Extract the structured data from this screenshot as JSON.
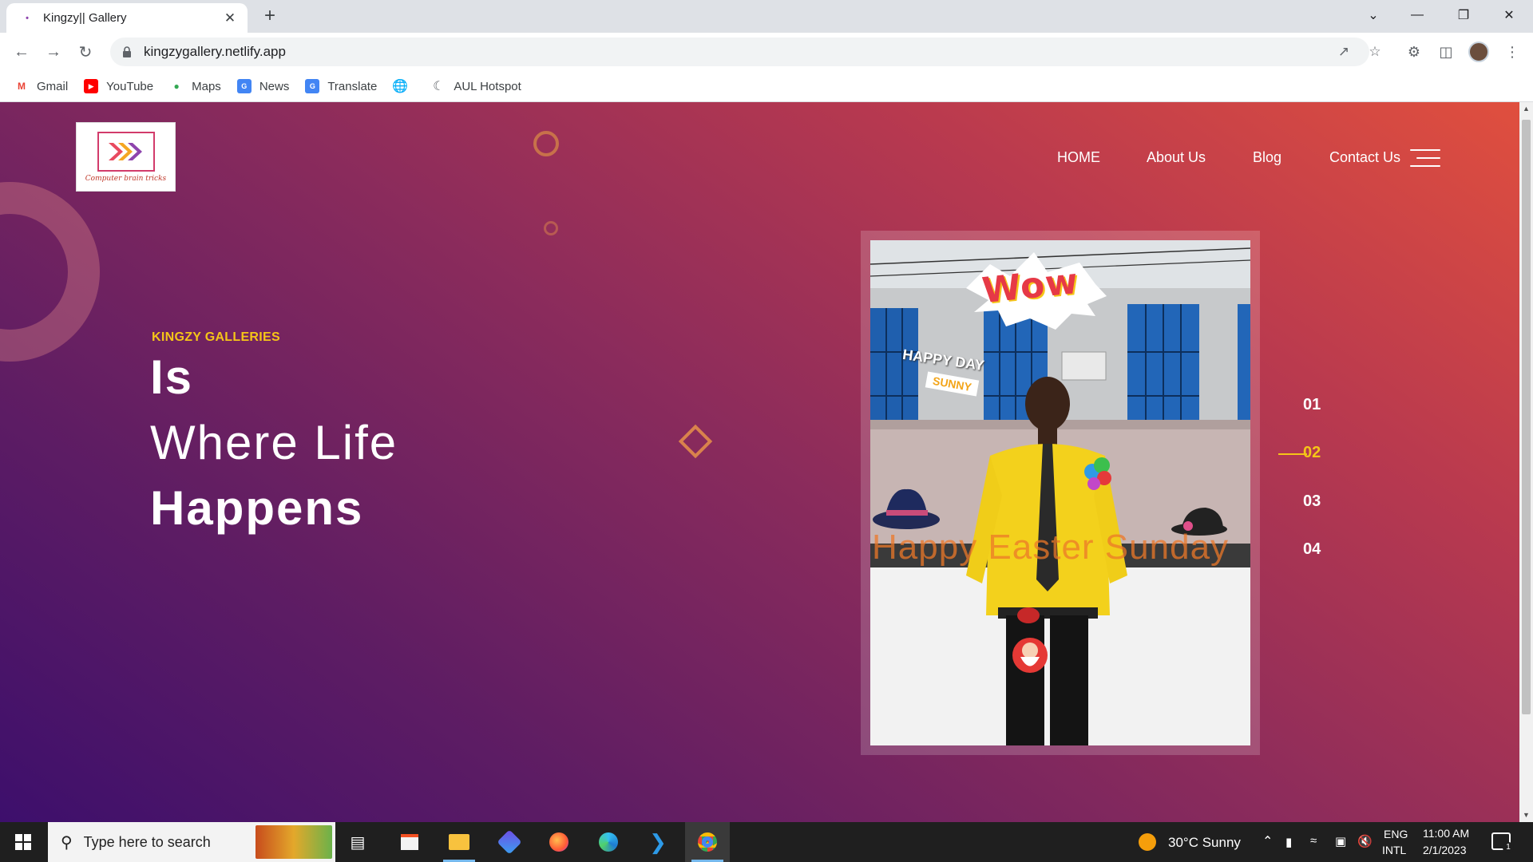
{
  "browser": {
    "tab_title": "Kingzy|| Gallery",
    "url": "kingzygallery.netlify.app",
    "bookmarks": [
      {
        "label": "Gmail",
        "icon": "gmail-icon",
        "color": "#ea4335"
      },
      {
        "label": "YouTube",
        "icon": "youtube-icon",
        "color": "#ff0000"
      },
      {
        "label": "Maps",
        "icon": "maps-icon",
        "color": "#34a853"
      },
      {
        "label": "News",
        "icon": "news-icon",
        "color": "#4285f4"
      },
      {
        "label": "Translate",
        "icon": "translate-icon",
        "color": "#4285f4"
      },
      {
        "label": "",
        "icon": "globe-icon",
        "color": "#5f6368"
      },
      {
        "label": "AUL Hotspot",
        "icon": "hotspot-icon",
        "color": "#5f6368"
      }
    ]
  },
  "site": {
    "logo_text": "Computer brain tricks",
    "nav": [
      "HOME",
      "About Us",
      "Blog",
      "Contact Us"
    ],
    "hero": {
      "subtitle": "KINGZY GALLERIES",
      "line1": "Is",
      "line2": "Where Life",
      "line3": "Happens"
    },
    "photo": {
      "sticker_wow": "Wow",
      "sticker_happy_day": "HAPPY DAY",
      "sticker_sunny": "SUNNY",
      "caption": "Happy Easter Sunday"
    },
    "slides": [
      "01",
      "02",
      "03",
      "04"
    ],
    "active_slide": "02",
    "colors": {
      "accent": "#f5c518",
      "gradient_start": "#3d0f6c",
      "gradient_end": "#e04f3e"
    }
  },
  "taskbar": {
    "search_placeholder": "Type here to search",
    "weather": "30°C  Sunny",
    "lang1": "ENG",
    "lang2": "INTL",
    "time": "11:00 AM",
    "date": "2/1/2023",
    "notification_count": "1"
  }
}
